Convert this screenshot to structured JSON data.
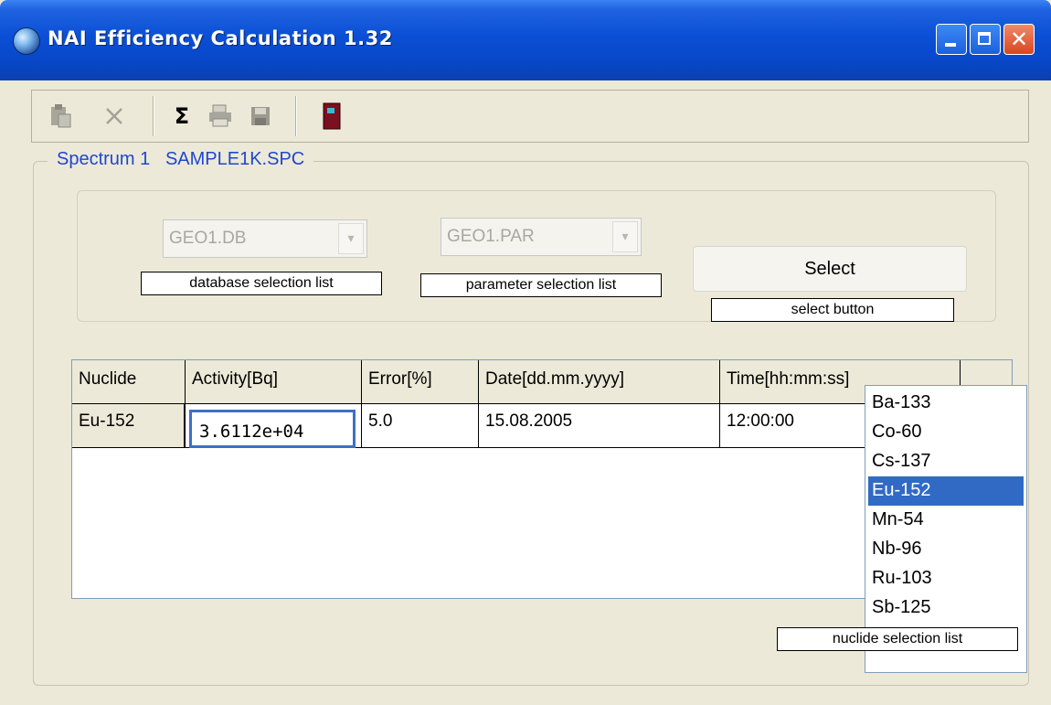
{
  "window": {
    "title": "NAI Efficiency Calculation 1.32"
  },
  "toolbar": {
    "icons": [
      "paste-icon",
      "delete-icon",
      "sum-icon",
      "print-icon",
      "save-icon",
      "exit-door-icon"
    ]
  },
  "spectrum": {
    "label": "Spectrum 1",
    "file": "SAMPLE1K.SPC"
  },
  "database": {
    "value": "GEO1.DB",
    "caption": "database selection list"
  },
  "parameter": {
    "value": "GEO1.PAR",
    "caption": "parameter selection list"
  },
  "select": {
    "label": "Select",
    "caption": "select button"
  },
  "table": {
    "headers": [
      "Nuclide",
      "Activity[Bq]",
      "Error[%]",
      "Date[dd.mm.yyyy]",
      "Time[hh:mm:ss]"
    ],
    "rows": [
      {
        "nuclide": "Eu-152",
        "activity": "3.6112e+04",
        "error": "5.0",
        "date": "15.08.2005",
        "time": "12:00:00"
      }
    ]
  },
  "nuclide_list": {
    "options": [
      "Ba-133",
      "Co-60",
      "Cs-137",
      "Eu-152",
      "Mn-54",
      "Nb-96",
      "Ru-103",
      "Sb-125"
    ],
    "selected": "Eu-152",
    "caption": "nuclide selection list"
  },
  "colors": {
    "title_bar": "#0a4fd6",
    "legend_text": "#1f47d0",
    "selection": "#316ac5",
    "window_bg": "#ece9d8"
  }
}
